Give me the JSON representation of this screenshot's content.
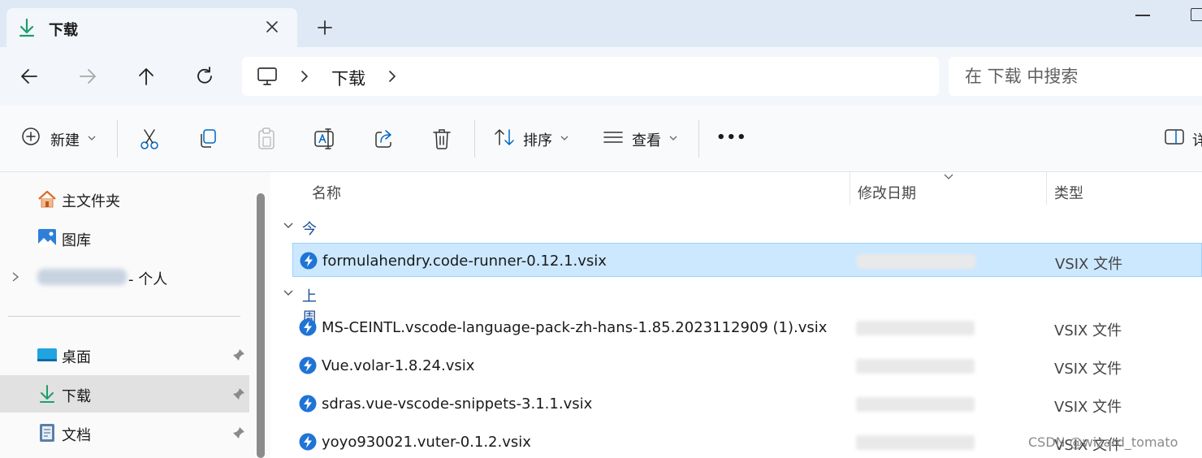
{
  "tab": {
    "title": "下载",
    "icon": "download-arrow-icon"
  },
  "nav": {
    "crumb": "下载",
    "search_placeholder": "在 下载 中搜索"
  },
  "commands": {
    "new_label": "新建",
    "sort_label": "排序",
    "view_label": "查看",
    "more_label": "•••",
    "details_label": "详"
  },
  "sidebar": {
    "home": "主文件夹",
    "gallery": "图库",
    "personal": "- 个人",
    "desktop": "桌面",
    "downloads": "下载",
    "documents": "文档"
  },
  "columns": {
    "name": "名称",
    "modified": "修改日期",
    "type": "类型"
  },
  "groups": [
    {
      "label": "今天",
      "files": [
        {
          "name": "formulahendry.code-runner-0.12.1.vsix",
          "type": "VSIX 文件",
          "selected": true
        }
      ]
    },
    {
      "label": "上周",
      "files": [
        {
          "name": "MS-CEINTL.vscode-language-pack-zh-hans-1.85.2023112909 (1).vsix",
          "type": "VSIX 文件"
        },
        {
          "name": "Vue.volar-1.8.24.vsix",
          "type": "VSIX 文件"
        },
        {
          "name": "sdras.vue-vscode-snippets-3.1.1.vsix",
          "type": "VSIX 文件"
        },
        {
          "name": "yoyo930021.vuter-0.1.2.vsix",
          "type": "VSIX 文件"
        }
      ]
    }
  ],
  "watermark": "CSDN @wizard_tomato",
  "colors": {
    "accent": "#0067c0",
    "selection": "#cce8ff",
    "download_green": "#1e9e6b",
    "vsix_blue": "#1f74d6"
  }
}
